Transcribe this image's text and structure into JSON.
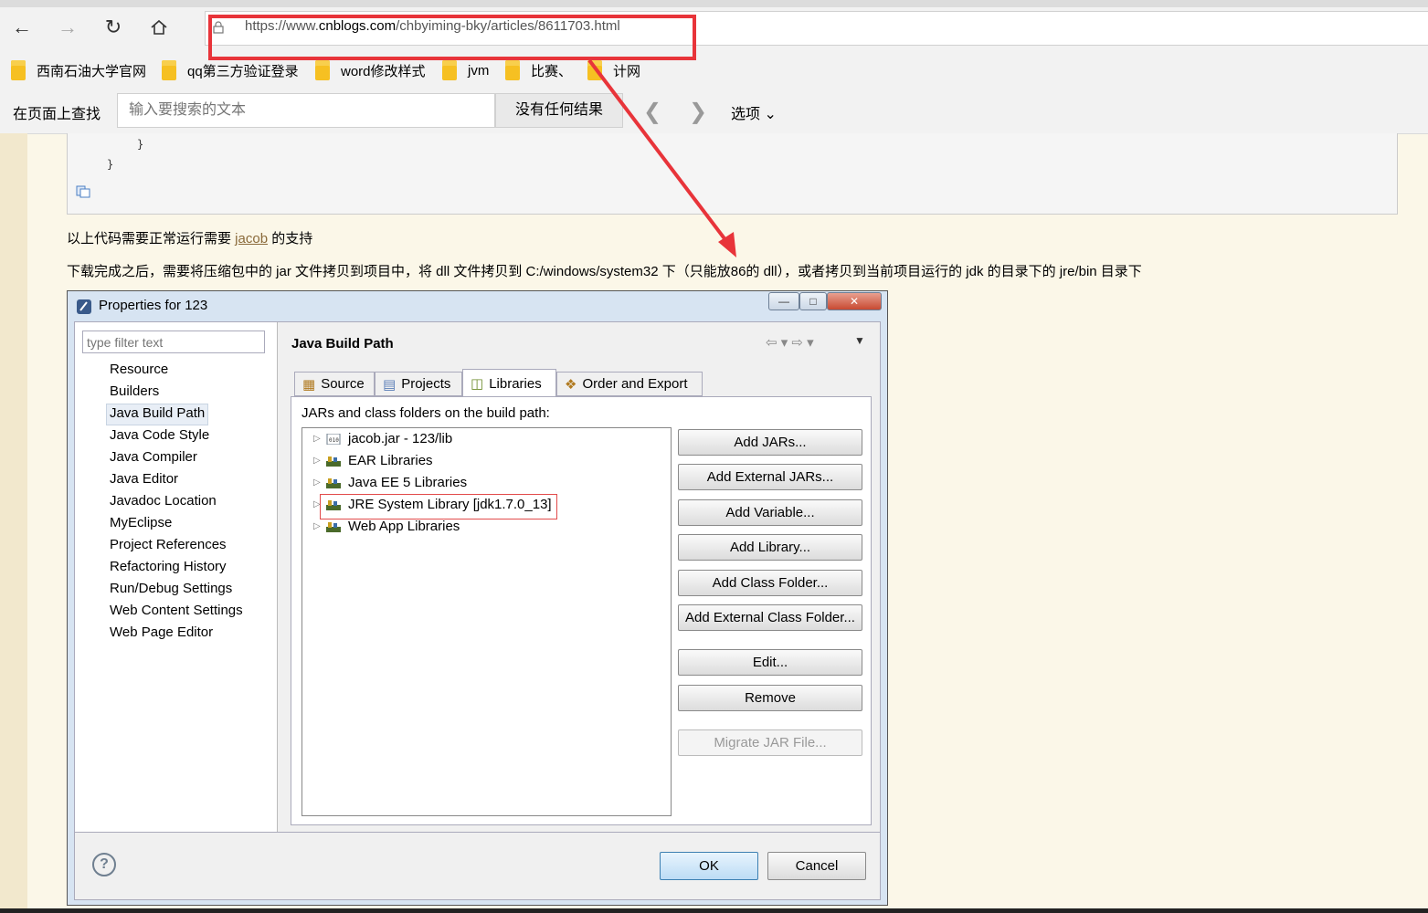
{
  "browser": {
    "url_prefix": "https://www.",
    "url_domain": "cnblogs.com",
    "url_path": "/chbyiming-bky/articles/8611703.html",
    "favorites": [
      "西南石油大学官网",
      "qq第三方验证登录",
      "word修改样式",
      "jvm",
      "比赛、",
      "计网"
    ],
    "find": {
      "label": "在页面上查找",
      "placeholder": "输入要搜索的文本",
      "result": "没有任何结果",
      "options": "选项"
    }
  },
  "article": {
    "code_lines": [
      "}",
      "}"
    ],
    "para1_before": "以上代码需要正常运行需要 ",
    "para1_link": "jacob",
    "para1_after": " 的支持",
    "para2": "下载完成之后，需要将压缩包中的 jar 文件拷贝到项目中，将 dll 文件拷贝到 C:/windows/system32 下（只能放86的 dll），或者拷贝到当前项目运行的 jdk 的目录下的 jre/bin 目录下"
  },
  "dialog": {
    "title": "Properties for 123",
    "filter_placeholder": "type filter text",
    "nav_items": [
      "Resource",
      "Builders",
      "Java Build Path",
      "Java Code Style",
      "Java Compiler",
      "Java Editor",
      "Javadoc Location",
      "MyEclipse",
      "Project References",
      "Refactoring History",
      "Run/Debug Settings",
      "Web Content Settings",
      "Web Page Editor"
    ],
    "selected_nav": "Java Build Path",
    "page_title": "Java Build Path",
    "tabs": [
      "Source",
      "Projects",
      "Libraries",
      "Order and Export"
    ],
    "active_tab": "Libraries",
    "panel_label": "JARs and class folders on the build path:",
    "tree": [
      "jacob.jar - 123/lib",
      "EAR Libraries",
      "Java EE 5 Libraries",
      "JRE System Library [jdk1.7.0_13]",
      "Web App Libraries"
    ],
    "buttons": [
      "Add JARs...",
      "Add External JARs...",
      "Add Variable...",
      "Add Library...",
      "Add Class Folder...",
      "Add External Class Folder...",
      "Edit...",
      "Remove",
      "Migrate JAR File..."
    ],
    "ok": "OK",
    "cancel": "Cancel"
  },
  "colors": {
    "annotation_red": "#e8343a",
    "page_bg": "#fbf7e8"
  }
}
